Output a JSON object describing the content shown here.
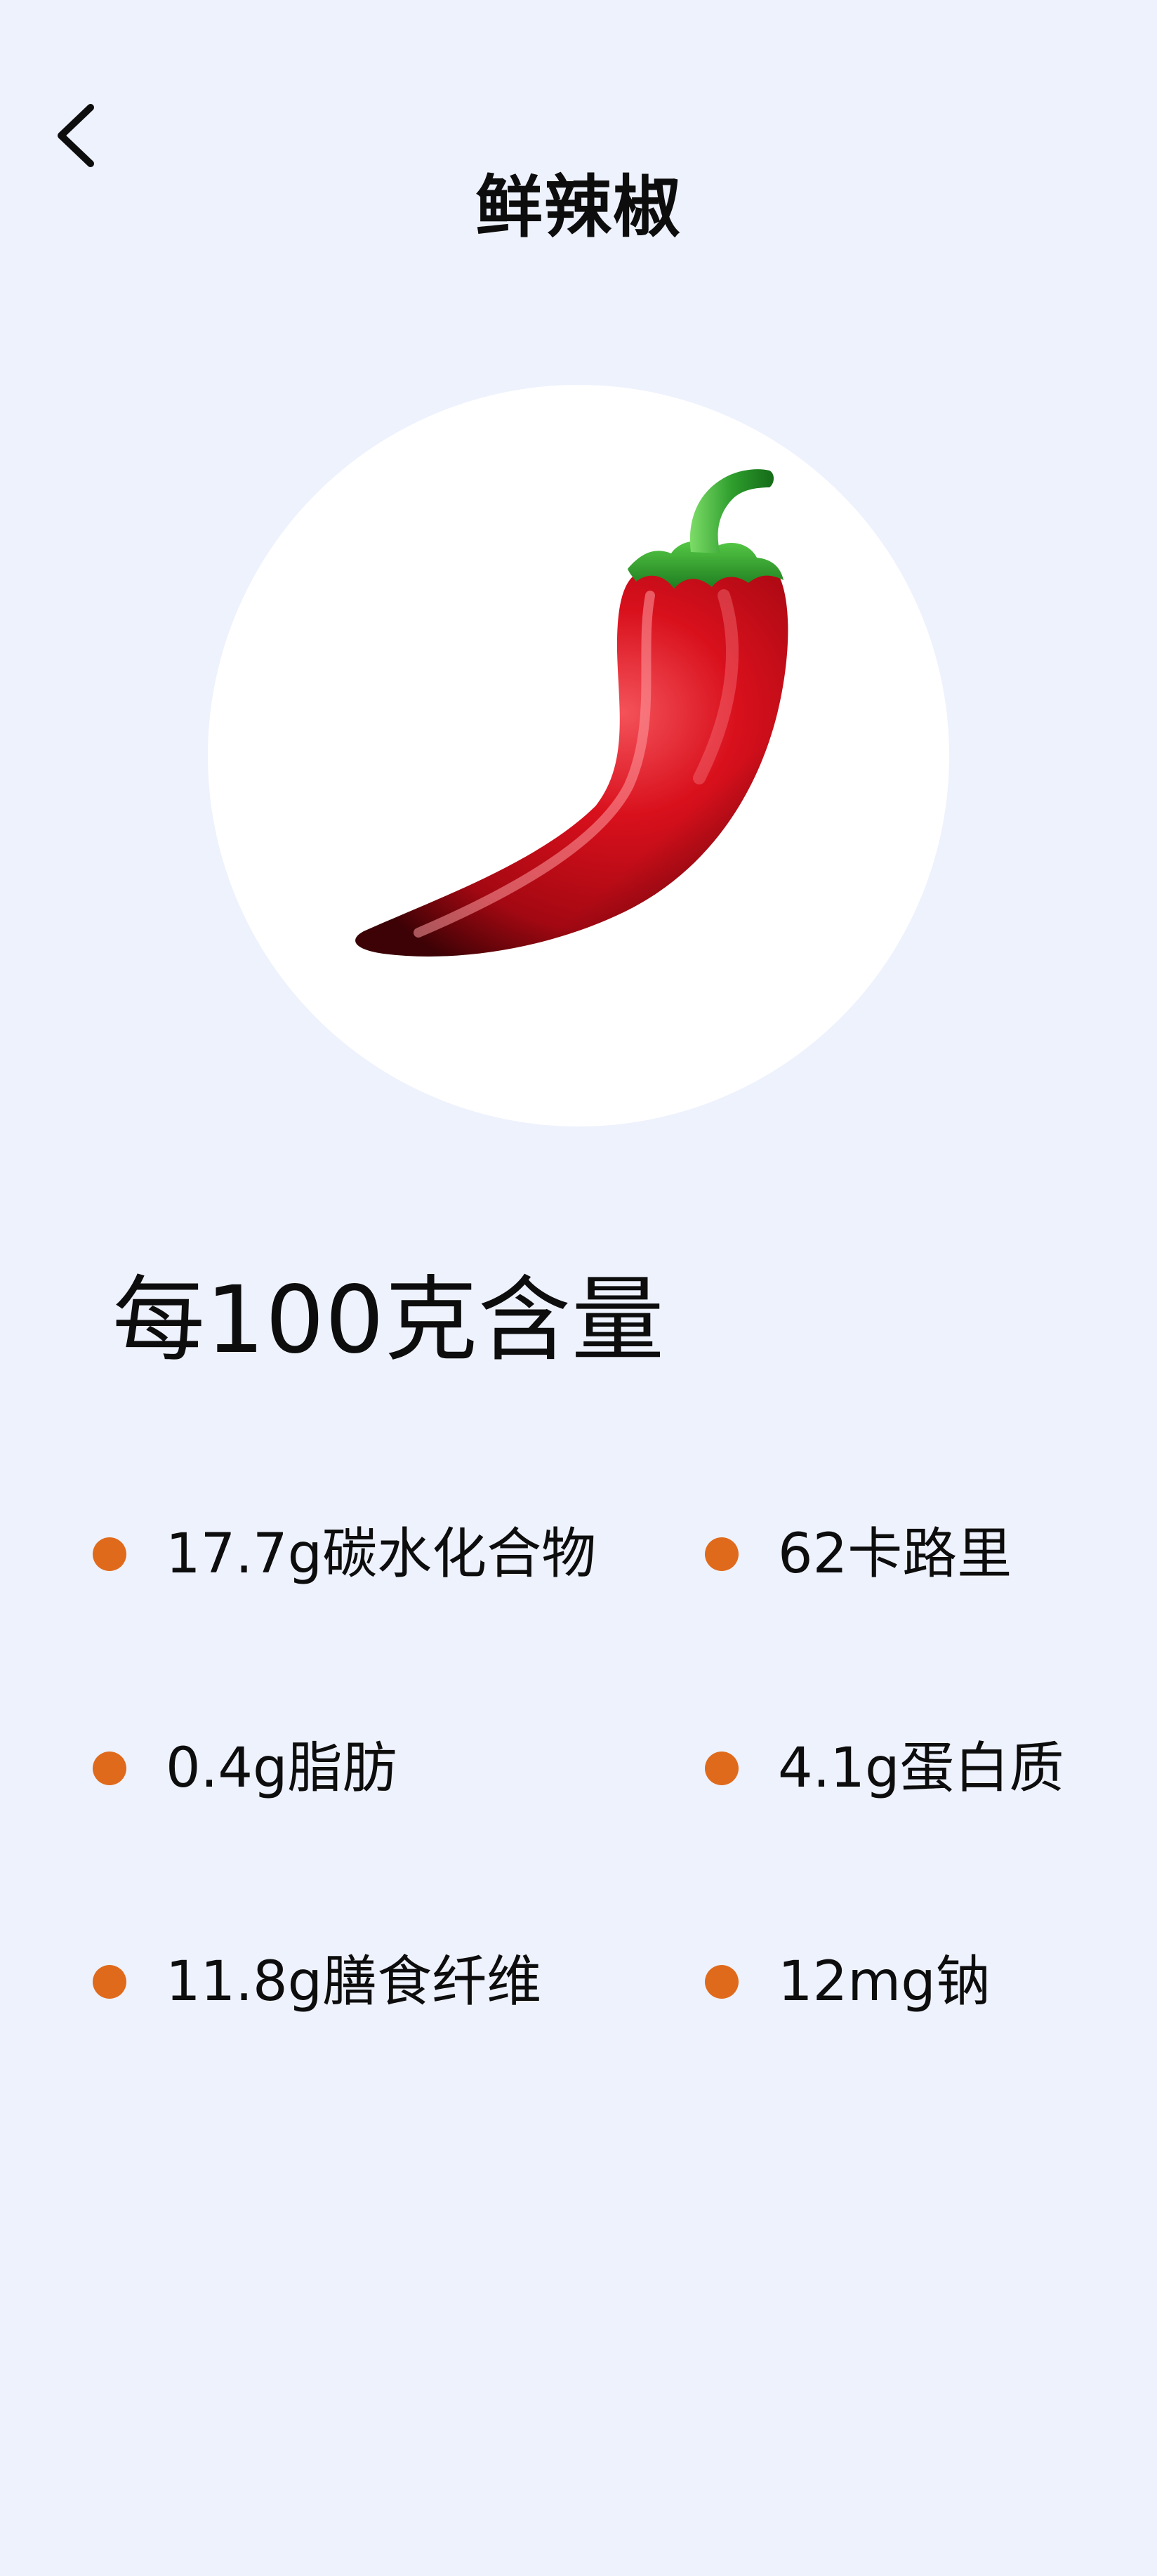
{
  "header": {
    "back_icon": "chevron-left-icon",
    "title": "鲜辣椒"
  },
  "hero": {
    "image": "red-chili-pepper",
    "circle_color": "#ffffff"
  },
  "nutrition": {
    "heading": "每100克含量",
    "bullet_color": "#e06a1b",
    "items": [
      {
        "text": "17.7g碳水化合物"
      },
      {
        "text": "62卡路里"
      },
      {
        "text": "0.4g脂肪"
      },
      {
        "text": "4.1g蛋白质"
      },
      {
        "text": "11.8g膳食纤维"
      },
      {
        "text": "12mg钠"
      }
    ]
  },
  "colors": {
    "background": "#eef2fd",
    "text": "#0d0d0d",
    "accent": "#e06a1b"
  }
}
